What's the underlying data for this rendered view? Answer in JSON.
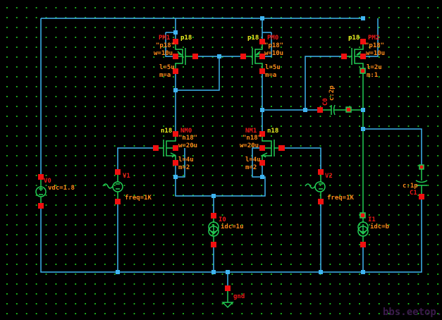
{
  "schematic": {
    "instances": {
      "PM1": {
        "name": "PM1",
        "cell": "p18",
        "model": "\"p18\"",
        "w": "w=10u",
        "l": "l=5u",
        "m": "m=a"
      },
      "PM0": {
        "name": "PM0",
        "cell": "p18",
        "model": "\"p18\"",
        "w": "w=10u",
        "l": "l=5u",
        "m": "m=a"
      },
      "PM2": {
        "name": "PM2",
        "cell": "p18",
        "model": "\"p18\"",
        "w": "w=10u",
        "l": "l=2u",
        "m": "m:1"
      },
      "NM0": {
        "name": "NM0",
        "cell": "n18",
        "model": "\"n18\"",
        "w": "w=20u",
        "l": "l=4u",
        "m": "m=2"
      },
      "NM1": {
        "name": "NM1",
        "cell": "n18",
        "model": "\"n18\"",
        "w": "w=20u",
        "l": "l=4u",
        "m": "m=2"
      },
      "V0": {
        "name": "V0",
        "param": "vdc=1.8"
      },
      "V1": {
        "name": "V1",
        "param": "freq=1K"
      },
      "V2": {
        "name": "V2",
        "param": "freq=1K"
      },
      "I0": {
        "name": "I0",
        "param": "idc=1u"
      },
      "I1": {
        "name": "I1",
        "param": "idc=b"
      },
      "C0": {
        "name": "C0",
        "param": "c:2p"
      },
      "C1": {
        "name": "C1",
        "param": "c:1p"
      },
      "gnd": {
        "name": "gnd"
      }
    },
    "colors": {
      "wire": "#3fb4f0",
      "symbol": "#22cc55",
      "pin": "#f01010",
      "instance_name": "#f01818",
      "cell_name": "#f0f020",
      "parameter": "#ff8a1a",
      "grid": "#1fbf1f",
      "background": "#000000"
    }
  },
  "watermark": "bbs.eetop.cn"
}
